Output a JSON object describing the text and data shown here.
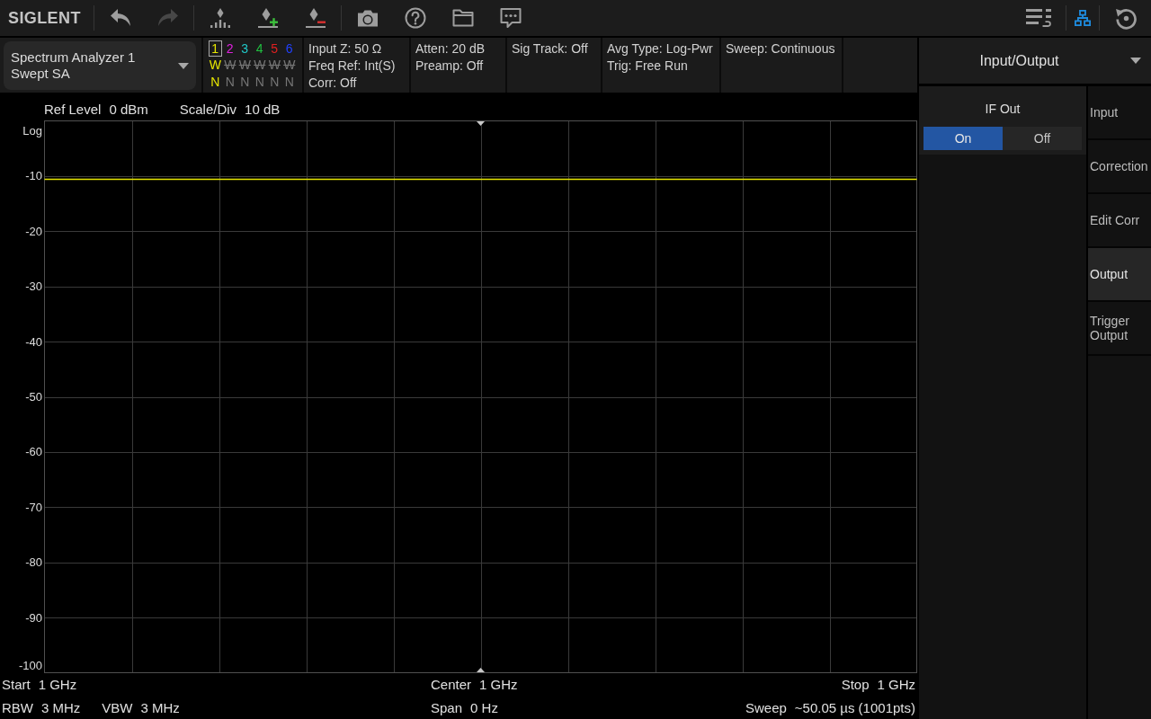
{
  "toolbar": {
    "brand": "SIGLENT",
    "tool_groups": [
      {
        "tools": [
          {
            "kind": "undo",
            "disabled": false
          },
          {
            "kind": "redo",
            "disabled": true
          }
        ]
      },
      {
        "tools": [
          {
            "kind": "peak",
            "disabled": false
          },
          {
            "kind": "marker_add",
            "disabled": false
          },
          {
            "kind": "marker_delete",
            "disabled": false
          }
        ]
      },
      {
        "tools": [
          {
            "kind": "screenshot",
            "disabled": false
          },
          {
            "kind": "help",
            "disabled": false
          },
          {
            "kind": "file",
            "disabled": false
          },
          {
            "kind": "message",
            "disabled": false
          }
        ]
      }
    ],
    "status_tools": [
      {
        "kind": "display_list",
        "disabled": false
      },
      {
        "kind": "network",
        "disabled": false
      },
      {
        "kind": "reset",
        "disabled": false
      }
    ]
  },
  "mode": {
    "lines": [
      "Spectrum Analyzer 1",
      "Swept SA"
    ]
  },
  "traces": [
    {
      "number": "1",
      "color": "#e6e600",
      "selected": true,
      "on": true,
      "type": "W",
      "detector": "N"
    },
    {
      "number": "2",
      "color": "#e020e0",
      "selected": false,
      "on": false,
      "type": "W",
      "detector": "N"
    },
    {
      "number": "3",
      "color": "#20c8c8",
      "selected": false,
      "on": false,
      "type": "W",
      "detector": "N"
    },
    {
      "number": "4",
      "color": "#20c040",
      "selected": false,
      "on": false,
      "type": "W",
      "detector": "N"
    },
    {
      "number": "5",
      "color": "#e02020",
      "selected": false,
      "on": false,
      "type": "W",
      "detector": "N"
    },
    {
      "number": "6",
      "color": "#2040ff",
      "selected": false,
      "on": false,
      "type": "W",
      "detector": "N"
    }
  ],
  "info_columns": [
    {
      "lines": [
        "Input Z: 50 Ω",
        "Freq Ref: Int(S)",
        "Corr: Off"
      ]
    },
    {
      "lines": [
        "Atten: 20 dB",
        "Preamp: Off"
      ]
    },
    {
      "lines": [
        "Sig Track: Off"
      ]
    },
    {
      "lines": [
        "Avg Type: Log-Pwr",
        "Trig: Free Run"
      ]
    },
    {
      "lines": [
        "Sweep: Continuous"
      ]
    }
  ],
  "display": {
    "header": [
      {
        "label": "Ref Level",
        "value": "0 dBm"
      },
      {
        "label": "Scale/Div",
        "value": "10 dB"
      }
    ],
    "chart_data": {
      "type": "line",
      "ylabel": "Log",
      "ylim": [
        -100,
        0
      ],
      "yticks": [
        -10,
        -20,
        -30,
        -40,
        -50,
        -60,
        -70,
        -80,
        -90,
        -100
      ],
      "grid": true,
      "series": [
        {
          "color": "#e6e600",
          "values": [
            -10.6,
            -10.6,
            -10.6,
            -10.6,
            -10.6,
            -10.6,
            -10.6,
            -10.6,
            -10.6,
            -10.6,
            -10.6
          ]
        }
      ]
    },
    "footer_rows": [
      {
        "left": [
          {
            "label": "Start",
            "value": "1 GHz"
          }
        ],
        "center": [
          {
            "label": "Center",
            "value": "1 GHz"
          }
        ],
        "right": [
          {
            "label": "Stop",
            "value": "1 GHz"
          }
        ]
      },
      {
        "left": [
          {
            "label": "RBW",
            "value": "3 MHz"
          },
          {
            "label": "VBW",
            "value": "3 MHz"
          }
        ],
        "center": [
          {
            "label": "Span",
            "value": "0 Hz"
          }
        ],
        "right": [
          {
            "label": "Sweep",
            "value": "~50.05 µs (1001pts)"
          }
        ]
      }
    ]
  },
  "menu": {
    "title": "Input/Output",
    "settings": [
      {
        "kind": "toggle",
        "label": "IF Out",
        "options": [
          {
            "label": "On",
            "selected": true
          },
          {
            "label": "Off",
            "selected": false
          }
        ]
      }
    ],
    "tabs": [
      {
        "label": "Input",
        "selected": false
      },
      {
        "label": "Correction",
        "selected": false
      },
      {
        "label": "Edit Corr",
        "selected": false
      },
      {
        "label": "Output",
        "selected": true
      },
      {
        "label": "Trigger Output",
        "selected": false
      }
    ]
  }
}
